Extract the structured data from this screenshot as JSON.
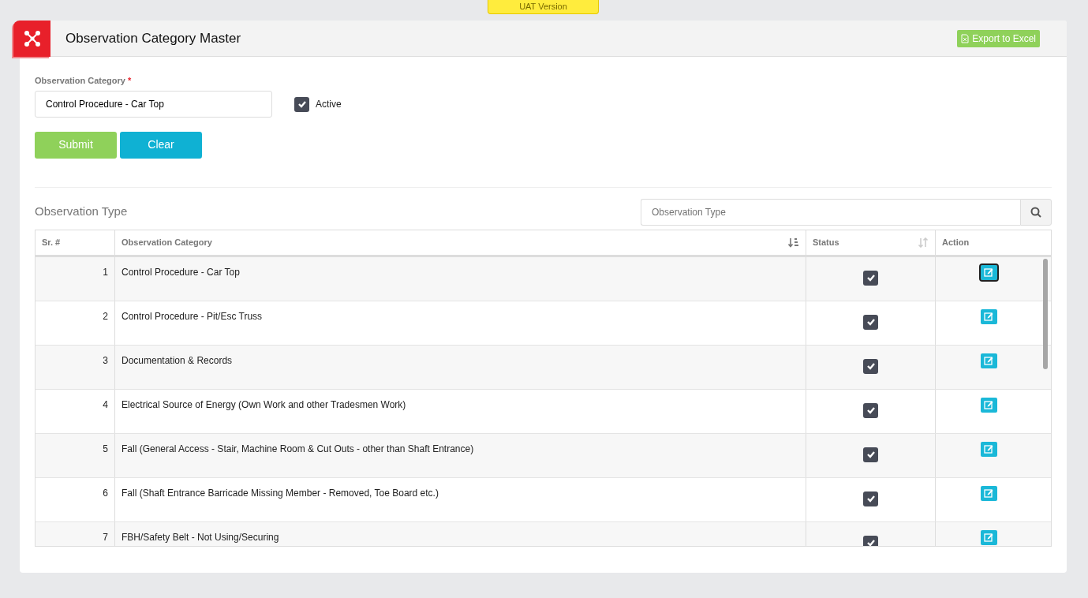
{
  "environment_badge": "UAT Version",
  "header": {
    "title": "Observation Category Master",
    "export_button": "Export to Excel"
  },
  "form": {
    "category_label": "Observation Category",
    "required_mark": "*",
    "category_value": "Control Procedure - Car Top",
    "active_label": "Active",
    "active_checked": true,
    "buttons": [
      {
        "kind": "submit",
        "label": "Submit"
      },
      {
        "kind": "clear",
        "label": "Clear"
      }
    ]
  },
  "list": {
    "title": "Observation Type",
    "search": {
      "placeholder": "Observation Type"
    },
    "table": {
      "columns": [
        {
          "label": "Sr. #",
          "kind": "plain"
        },
        {
          "label": "Observation Category",
          "kind": "sorted"
        },
        {
          "label": "Status",
          "kind": "sortable"
        },
        {
          "label": "Action",
          "kind": "plain"
        }
      ],
      "rows": [
        {
          "sr": "1",
          "category": "Control Procedure - Car Top",
          "status_checked": true,
          "focused": true
        },
        {
          "sr": "2",
          "category": "Control Procedure - Pit/Esc Truss",
          "status_checked": true,
          "focused": false
        },
        {
          "sr": "3",
          "category": "Documentation & Records",
          "status_checked": true,
          "focused": false
        },
        {
          "sr": "4",
          "category": "Electrical Source of Energy (Own Work and other Tradesmen Work)",
          "status_checked": true,
          "focused": false
        },
        {
          "sr": "5",
          "category": "Fall (General Access - Stair, Machine Room & Cut Outs - other than Shaft Entrance)",
          "status_checked": true,
          "focused": false
        },
        {
          "sr": "6",
          "category": "Fall (Shaft Entrance Barricade Missing Member - Removed, Toe Board etc.)",
          "status_checked": true,
          "focused": false
        },
        {
          "sr": "7",
          "category": "FBH/Safety Belt - Not Using/Securing",
          "status_checked": true,
          "focused": false
        }
      ]
    }
  }
}
